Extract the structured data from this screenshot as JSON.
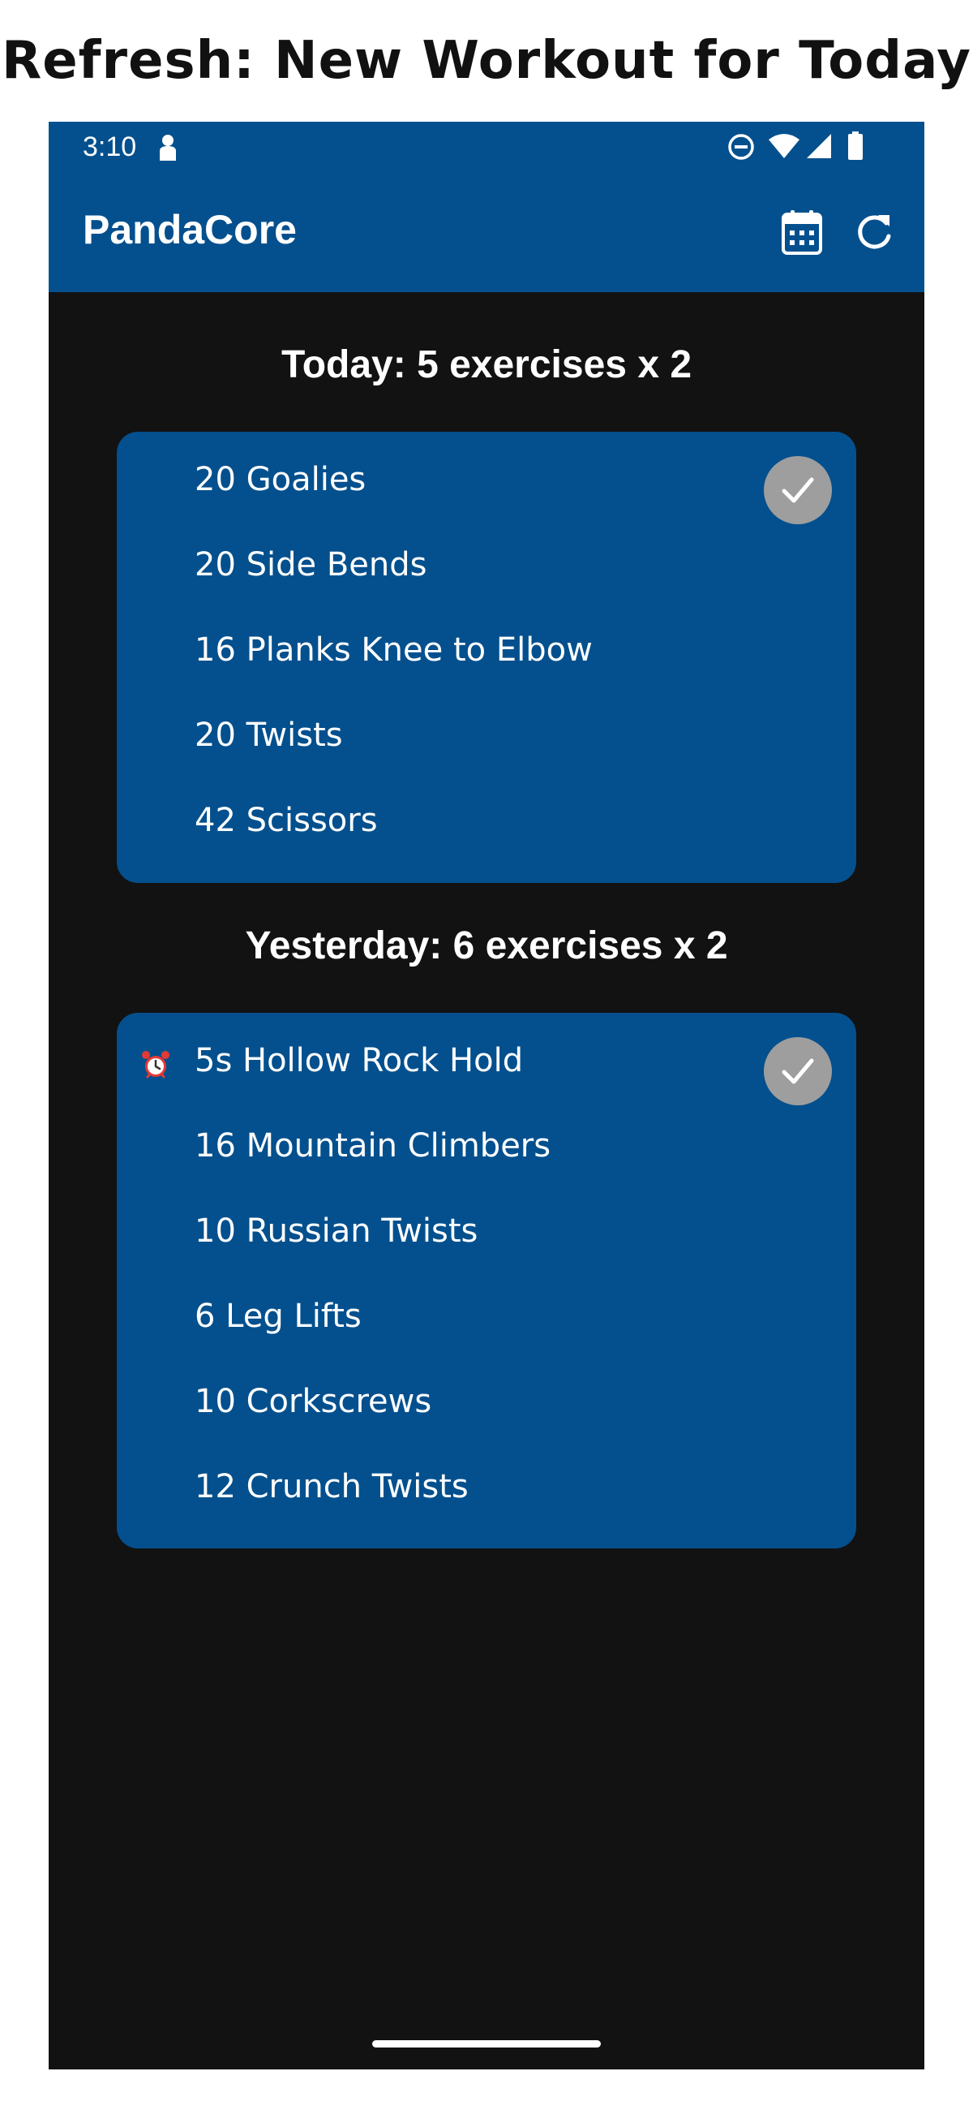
{
  "caption": "Refresh: New Workout for Today",
  "status_bar": {
    "time": "3:10",
    "icons": [
      "lock-person-icon",
      "do-not-disturb-icon",
      "wifi-icon",
      "cell-signal-icon",
      "battery-icon"
    ]
  },
  "app_bar": {
    "title": "PandaCore",
    "actions": [
      "calendar-icon",
      "refresh-icon"
    ]
  },
  "colors": {
    "primary": "#04508e",
    "background": "#121212",
    "check_circle": "#9e9e9e",
    "text": "#ffffff"
  },
  "today": {
    "heading": "Today: 5 exercises x 2",
    "exercises": [
      {
        "label": "20 Goalies"
      },
      {
        "label": "20 Side Bends"
      },
      {
        "label": "16 Planks Knee to Elbow"
      },
      {
        "label": "20 Twists"
      },
      {
        "label": "42 Scissors"
      }
    ]
  },
  "yesterday": {
    "heading": "Yesterday: 6 exercises x 2",
    "exercises": [
      {
        "label": "5s Hollow Rock Hold",
        "icon": "alarm-clock-icon"
      },
      {
        "label": "16 Mountain Climbers"
      },
      {
        "label": "10 Russian Twists"
      },
      {
        "label": "6 Leg Lifts"
      },
      {
        "label": "10 Corkscrews"
      },
      {
        "label": "12 Crunch Twists"
      }
    ]
  }
}
